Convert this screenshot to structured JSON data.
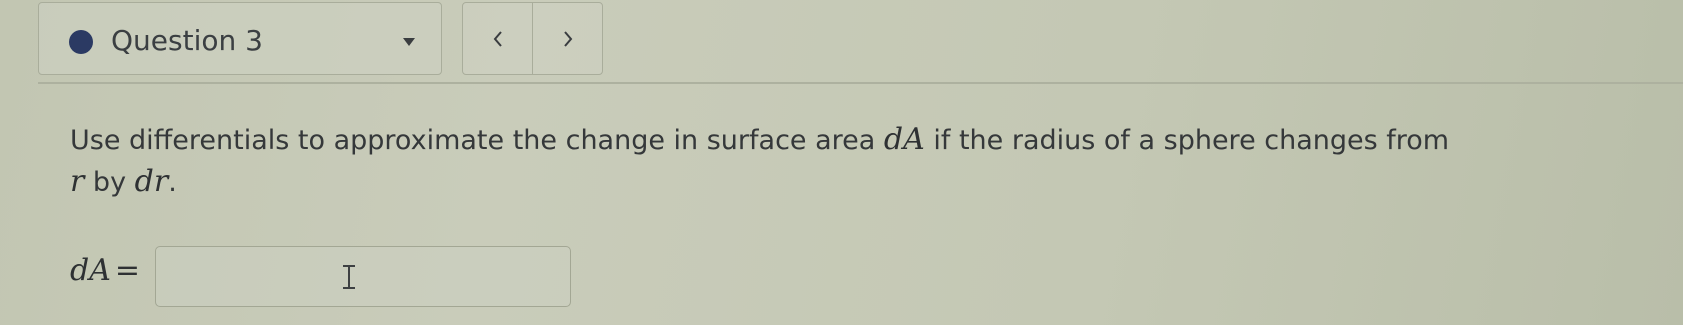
{
  "question_nav": {
    "status": "unanswered",
    "status_color": "#2b3a63",
    "label": "Question 3",
    "dropdown_icon": "caret-down-icon",
    "prev_icon": "chevron-left-icon",
    "next_icon": "chevron-right-icon"
  },
  "prompt": {
    "text_before": "Use differentials to approximate the change in surface area ",
    "symbol_area": "dA",
    "text_middle": " if the radius of a sphere changes from",
    "symbol_r": "r",
    "text_by": " by ",
    "symbol_dr": "dr",
    "text_end": "."
  },
  "answer": {
    "label": "dA",
    "equals": "=",
    "value": "",
    "cursor_icon": "text-cursor-icon"
  }
}
